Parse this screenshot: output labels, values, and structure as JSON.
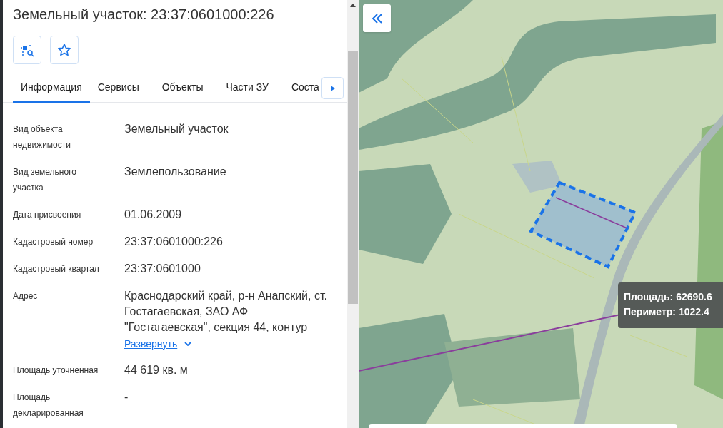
{
  "title": "Земельный участок: 23:37:0601000:226",
  "tabs": [
    {
      "label": "Информация",
      "selected": true
    },
    {
      "label": "Сервисы",
      "selected": false
    },
    {
      "label": "Объекты",
      "selected": false
    },
    {
      "label": "Части ЗУ",
      "selected": false
    },
    {
      "label": "Соста",
      "selected": false
    }
  ],
  "fields": [
    {
      "label": "Вид объекта недвижимости",
      "value": "Земельный участок"
    },
    {
      "label": "Вид земельного участка",
      "value": "Землепользование"
    },
    {
      "label": "Дата присвоения",
      "value": "01.06.2009"
    },
    {
      "label": "Кадастровый номер",
      "value": "23:37:0601000:226"
    },
    {
      "label": "Кадастровый квартал",
      "value": "23:37:0601000"
    },
    {
      "label": "Адрес",
      "value": "Краснодарский край, р-н Анапский, ст. Гостагаевская, ЗАО АФ \"Гостагаевская\", секция 44, контур",
      "expand_link": "Развернуть"
    },
    {
      "label": "Площадь уточненная",
      "value": "44 619 кв. м"
    },
    {
      "label": "Площадь декларированная",
      "value": "-"
    }
  ],
  "measure_tooltip": [
    "Площадь: 62690.6",
    "Периметр: 1022.4"
  ]
}
